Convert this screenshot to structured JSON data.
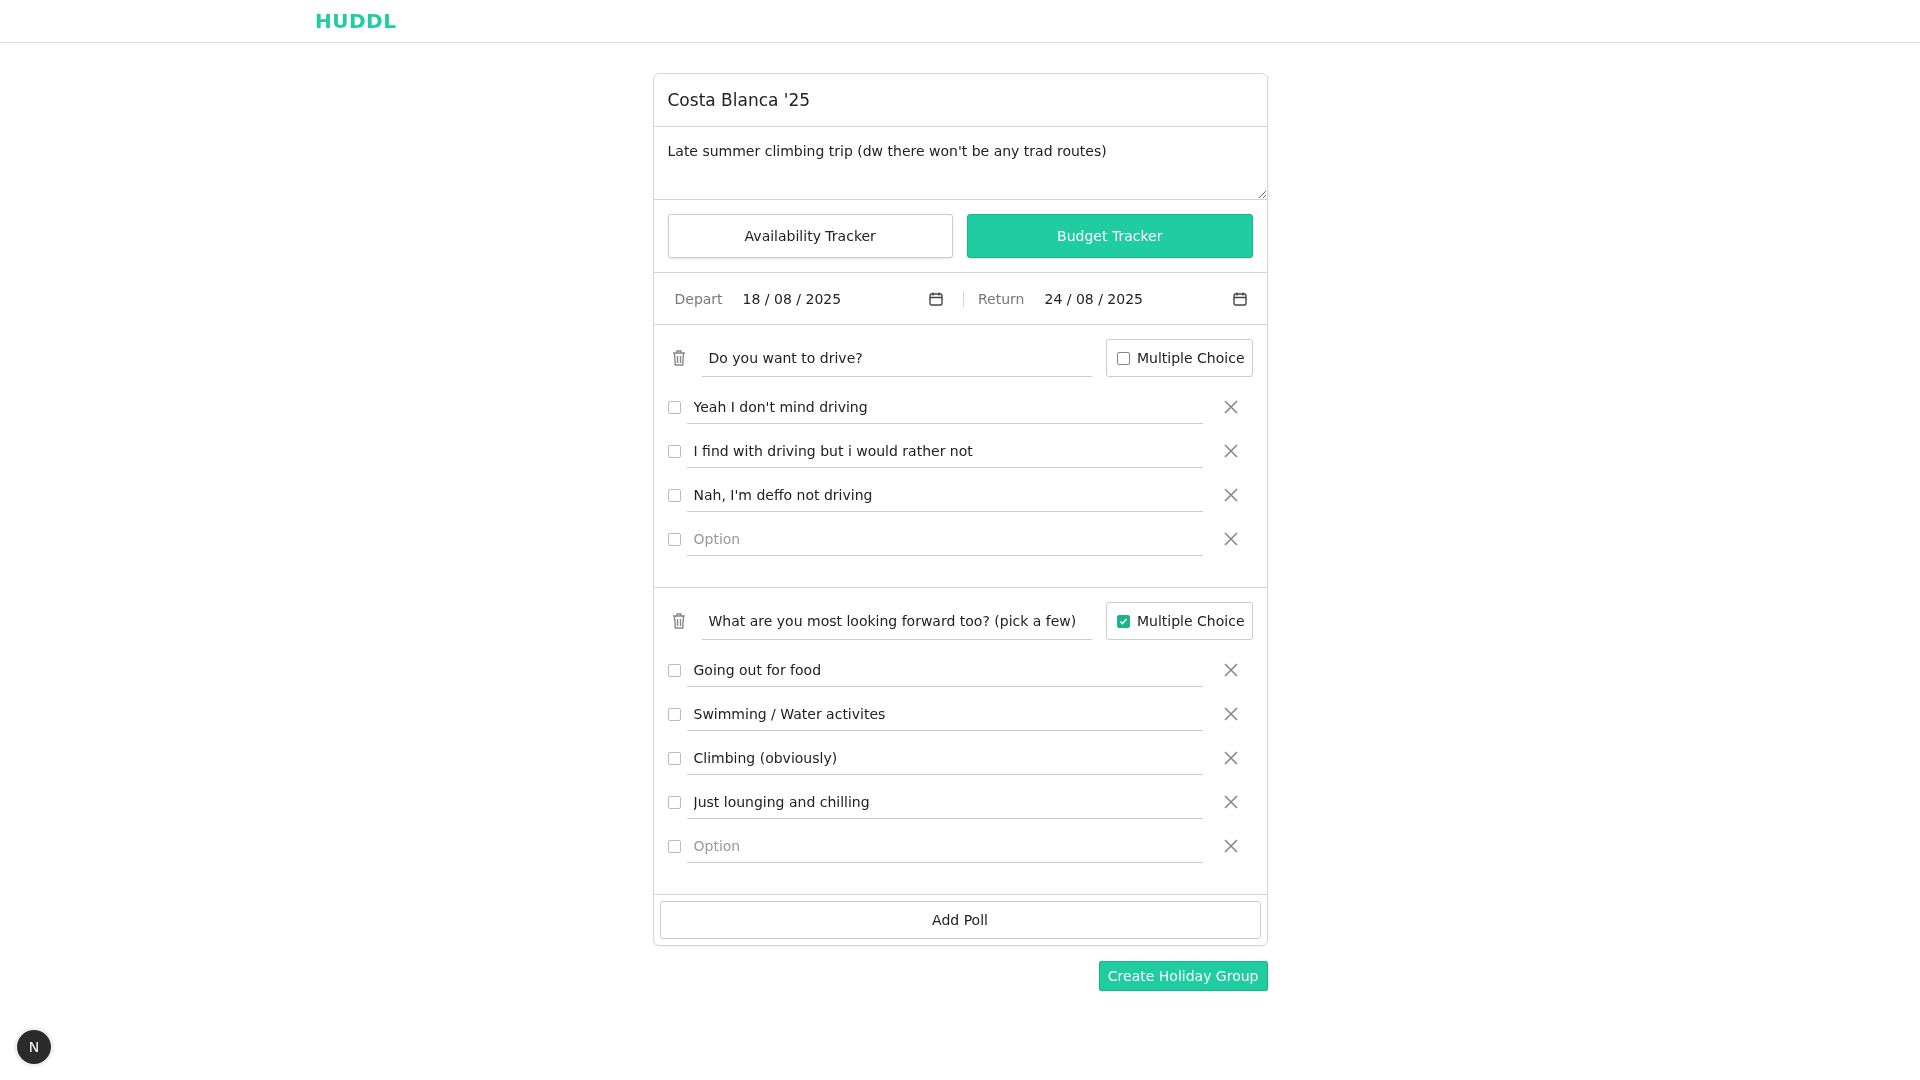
{
  "app": {
    "logo": "HUDDL"
  },
  "group": {
    "title": "Costa Blanca '25",
    "description": "Late summer climbing trip (dw there won't be any trad routes)",
    "tabs": [
      {
        "label": "Availability Tracker",
        "selected": false
      },
      {
        "label": "Budget Tracker",
        "selected": true
      }
    ],
    "dates": [
      {
        "label": "Depart",
        "value": "18 / 08 / 2025"
      },
      {
        "label": "Return",
        "value": "24 / 08 / 2025"
      }
    ],
    "polls": [
      {
        "question": "Do you want to drive?",
        "multiple_choice": {
          "label": "Multiple Choice",
          "checked": false
        },
        "options": [
          {
            "text": "Yeah I don't mind driving",
            "checked": false
          },
          {
            "text": "I find with driving but i would rather not",
            "checked": false
          },
          {
            "text": "Nah, I'm deffo not driving",
            "checked": false
          },
          {
            "placeholder": "Option",
            "checked": false
          }
        ]
      },
      {
        "question": "What are you most looking forward too? (pick a few)",
        "multiple_choice": {
          "label": "Multiple Choice",
          "checked": true
        },
        "options": [
          {
            "text": "Going out for food",
            "checked": false
          },
          {
            "text": "Swimming / Water activites",
            "checked": false
          },
          {
            "text": "Climbing (obviously)",
            "checked": false
          },
          {
            "text": "Just lounging and chilling",
            "checked": false
          },
          {
            "placeholder": "Option",
            "checked": false
          }
        ]
      }
    ],
    "add_poll": "Add Poll"
  },
  "submit": "Create Holiday Group",
  "dev_badge": "N"
}
